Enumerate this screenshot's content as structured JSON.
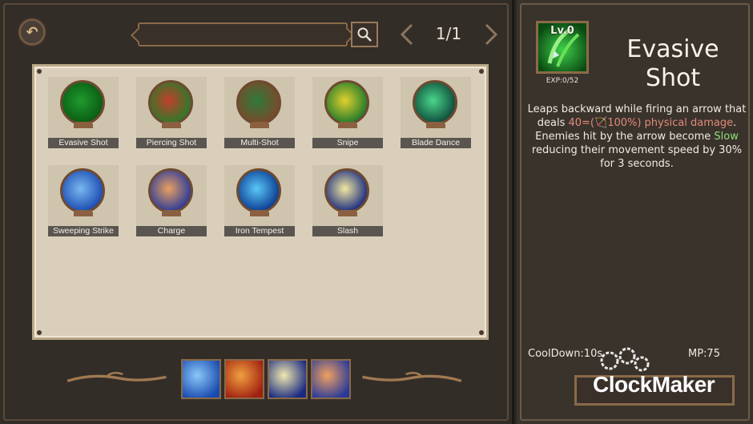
{
  "header": {
    "page_indicator": "1/1",
    "search_placeholder": ""
  },
  "skills": [
    {
      "label": "Evasive Shot",
      "colors": [
        "#1f9a2e",
        "#0a5a12"
      ]
    },
    {
      "label": "Piercing Shot",
      "colors": [
        "#c2402a",
        "#2a7a2a"
      ]
    },
    {
      "label": "Multi-Shot",
      "colors": [
        "#2f7a3a",
        "#7a4a2a"
      ]
    },
    {
      "label": "Snipe",
      "colors": [
        "#e0d030",
        "#1f7a2a"
      ]
    },
    {
      "label": "Blade Dance",
      "colors": [
        "#4ad68a",
        "#0e4a3a"
      ]
    },
    {
      "label": "Sweeping Strike",
      "colors": [
        "#7ab8f0",
        "#1a4ab0"
      ]
    },
    {
      "label": "Charge",
      "colors": [
        "#e8a060",
        "#2a3a9a"
      ]
    },
    {
      "label": "Iron Tempest",
      "colors": [
        "#5ac8f8",
        "#0a3a90"
      ]
    },
    {
      "label": "Slash",
      "colors": [
        "#f0e8a0",
        "#1a2a80"
      ]
    }
  ],
  "equipped": [
    {
      "colors": [
        "#8ac8f8",
        "#1a4ab0"
      ]
    },
    {
      "colors": [
        "#f0a040",
        "#a02010"
      ]
    },
    {
      "colors": [
        "#f0e8b0",
        "#1a2a80"
      ]
    },
    {
      "colors": [
        "#f0a060",
        "#2a3a9a"
      ]
    }
  ],
  "detail": {
    "level": "Lv.0",
    "exp": "EXP:0/52",
    "title_line1": "Evasive",
    "title_line2": "Shot",
    "desc_part1": "Leaps backward while firing an arrow that deals ",
    "desc_damage": "40=(",
    "desc_damage_pct": "100%) physical damage",
    "desc_part2": ". Enemies hit by the arrow become ",
    "desc_slow": "Slow",
    "desc_part3": " reducing their movement speed by 30% for 3 seconds.",
    "cooldown": "CoolDown:10s",
    "mp": "MP:75"
  },
  "watermark": "ClockMaker"
}
